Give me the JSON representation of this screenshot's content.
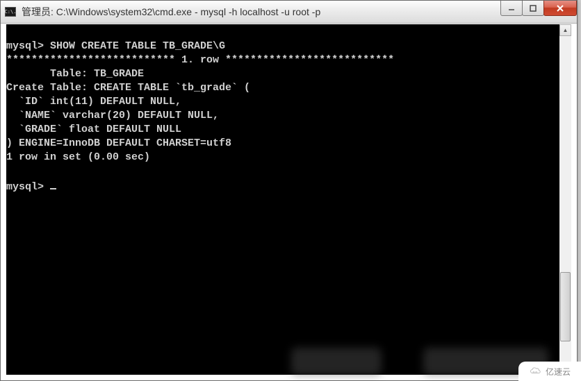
{
  "window": {
    "title": "管理员: C:\\Windows\\system32\\cmd.exe - mysql  -h localhost -u root -p",
    "icon_label": "C:\\."
  },
  "terminal": {
    "lines": [
      "mysql> SHOW CREATE TABLE TB_GRADE\\G",
      "*************************** 1. row ***************************",
      "       Table: TB_GRADE",
      "Create Table: CREATE TABLE `tb_grade` (",
      "  `ID` int(11) DEFAULT NULL,",
      "  `NAME` varchar(20) DEFAULT NULL,",
      "  `GRADE` float DEFAULT NULL",
      ") ENGINE=InnoDB DEFAULT CHARSET=utf8",
      "1 row in set (0.00 sec)",
      "",
      "mysql>"
    ]
  },
  "badge": {
    "text": "亿速云"
  }
}
